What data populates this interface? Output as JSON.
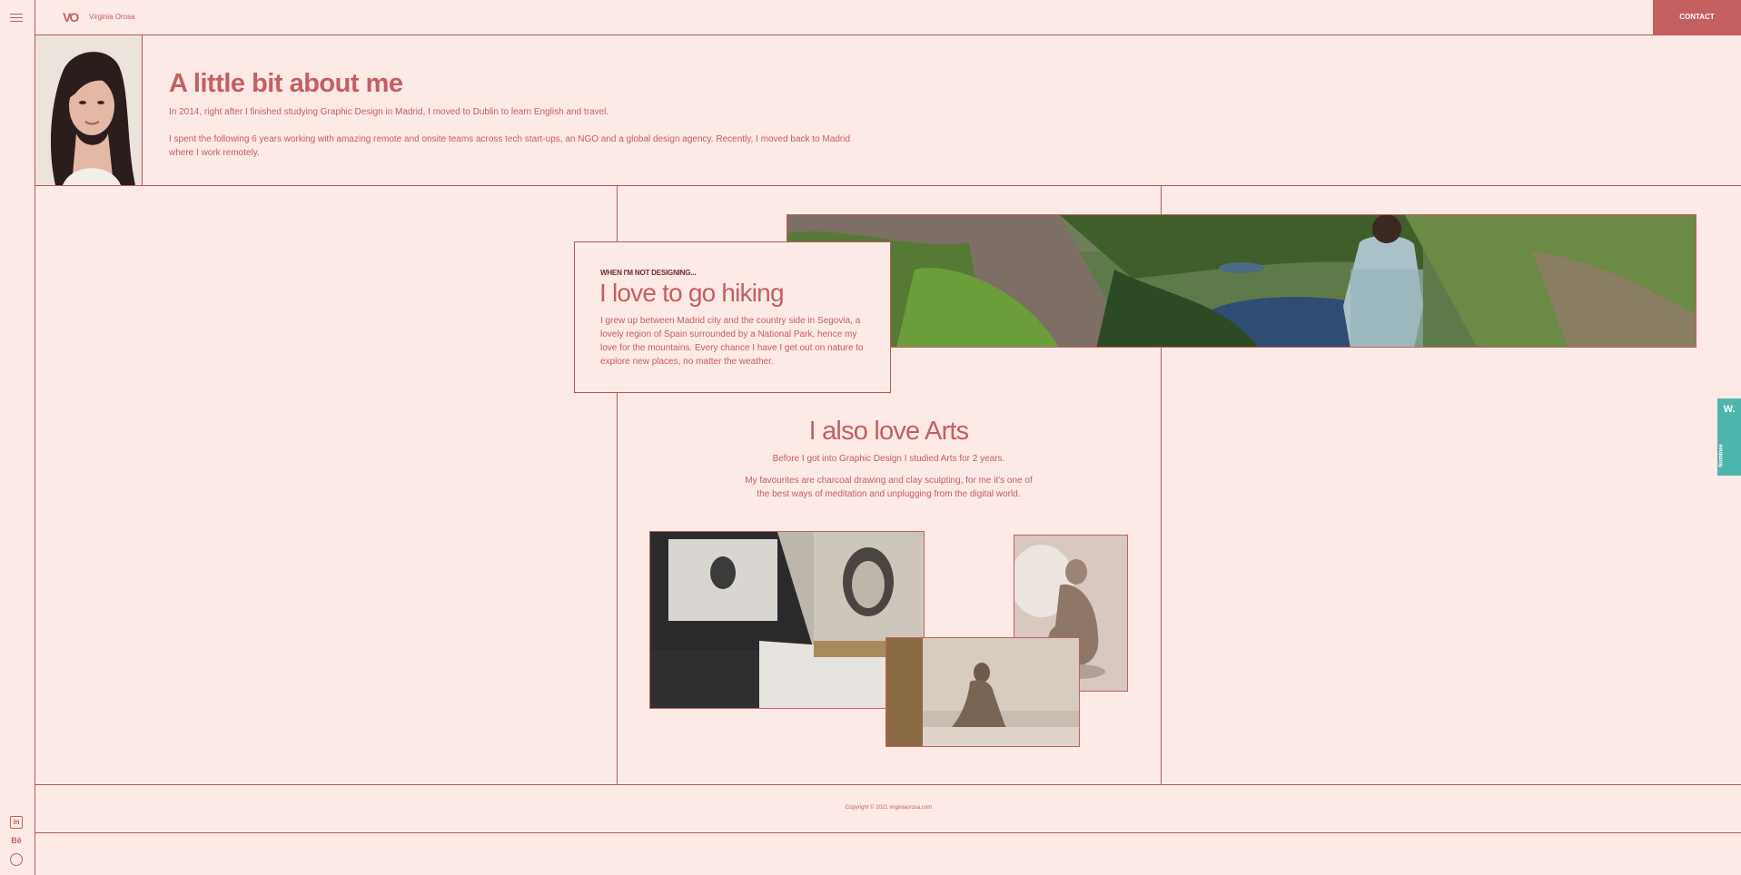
{
  "header": {
    "logo_mark": "VO",
    "site_name": "Virginia Orosa",
    "contact_label": "CONTACT"
  },
  "about": {
    "title": "A little bit about me",
    "paragraph_1": "In 2014, right after I finished studying Graphic Design in Madrid, I moved to Dublin to learn English and travel.",
    "paragraph_2": "I spent the following 6 years working with amazing remote and onsite teams across tech start-ups, an NGO and a global design agency. Recently, I moved back to Madrid where I work remotely."
  },
  "hiking": {
    "kicker": "WHEN I'M NOT DESIGNING...",
    "title": "I love to go hiking",
    "text": "I grew up between Madrid city and the country side in Segovia, a lovely region of Spain surrounded by a National Park, hence my love for the mountains. Every chance I have I get out on nature to explore new places, no matter the weather."
  },
  "arts": {
    "title": "I also love Arts",
    "paragraph_1": "Before I got into Graphic Design I studied Arts for 2 years.",
    "paragraph_2": "My favourites are charcoal drawing and clay sculpting, for me it's one of the best ways of meditation and unplugging from the digital world."
  },
  "footer": {
    "copyright": "Copyright © 2021 virginiaorosa.com"
  },
  "social": {
    "linkedin_glyph": "in",
    "behance_glyph": "Bē",
    "dribbble_glyph": "◎"
  },
  "badge": {
    "w": "W.",
    "label": "Nominee"
  },
  "colors": {
    "background": "#fde9e6",
    "accent": "#c45f61",
    "badge": "#4db6ac"
  }
}
